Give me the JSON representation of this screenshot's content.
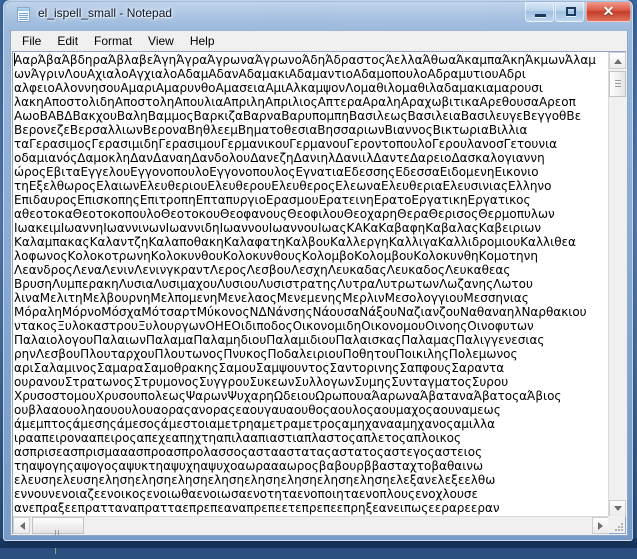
{
  "window": {
    "title": "el_ispell_small - Notepad",
    "icon": "notepad-document-icon",
    "controls": {
      "minimize": "–",
      "maximize": "□",
      "close": "✕"
    }
  },
  "menu": {
    "items": [
      {
        "label": "File"
      },
      {
        "label": "Edit"
      },
      {
        "label": "Format"
      },
      {
        "label": "View"
      },
      {
        "label": "Help"
      }
    ]
  },
  "document": {
    "word_wrap": false,
    "lines": [
      "ΑαρΆβαΆβδηραΆβλαβεΆγηΆγραΆγρωναΆγρωνοΆδηΆδραστοςΆελλαΆθωαΆκαμπαΆκηΆκμωνΆλαμ",
      "ωνΆγρινΛουΑχιαλοΑγχιαλοΑδαμΑδανΑδαμακιΑδαμαντιοΑδαμοπουλοΑδραμυτιουΑδρι",
      "αλφειοΑλοννησουΑμαριΑμαρυνθοΑμασειαΑμιΑλκαμψονΛομαθιλομαθιλαδαμακιαμαρουσι",
      "λακηΑποστολιδηΑποστοληΑπουλιαΑπριληΑπριλιοςΑπτεραΑραληΑραχωβιτικαΑρεθουσαΑρεοπ",
      "ΑωοΒΑΒΔΒακχουΒαληΒαμμοςΒαρκιζαΒαρναΒαρυπομπηΒασιλεωςΒασιλειαΒασιλευγεΒεγγοθΒε",
      "ΒερονεζεΒερσαλλιωνΒεροναΒηθλεεμΒηματοθεσιαΒησσαριωνΒιαννοςΒικτωριαΒιλλια",
      "ταΓερασιμοςΓερασιμιδηΓερασιμουΓερμανικουΓερμανουΓεροντοπουλοΓερουλανοσΓετουνια",
      "οδαμιανόςΔαμοκληΔανΔαναηΔανδολουΔανεζηΔανιηλΔανιιλΔαντεΔαρειοΔασκαλογιαννη",
      "ώροςΕβιταΕγγελουΕγγονοπουλοΕγγονοπουλοςΕγνατιαΕδεσσηςΕδεσσαΕιδομενηΕικονιο",
      "τηΕξελθωροςΕλαιωνΕλευθεριουΕλευθερουΕλευθεροςΕλεωναΕλευθεριαΕλευσινιαςΕλληνο",
      "ΕπιδαυροςΕπισκοπηςΕπιτροπηΕπταπυργιοΕρασμουΕρατεινηΕρατοΕργατικηΕργατικος",
      "αθεοτοκαΘεοτοκοπουλοΘεοτοκουΘεοφανουςΘεοφιλουΘεοχαρηΘεραΘερισοςΘερμοπυλων",
      "ΙωακειμΙωαννηΙωαννινωνΙωαννιδηΙωαννουΙωαννουΙωαςΚΑΚαΚαβαφηΚαβαλαςΚαβειριων",
      "ΚαλαμπακαςΚαλαντζηΚαλαποθακηΚαλαφατηΚαλβουΚαλλεργηΚαλλιγαΚαλλιδρομιουΚαλλιθεα",
      "λοφωνοςΚολοκοτρωνηΚολοκυνθουΚολοκυνθουςΚολομβοΚολομβουΚολοκυνθηΚομοτηνη",
      "ΛεανδροςΛεναΛενινΛενινγκραντΛεροςΛεσβουΛεσχηΛευκαδαςΛευκαδοςΛευκαθεας",
      "ΒρυσηΛυμπερακηΛυσιαΛυσιμαχουΛυσιουΛυσιστρατηςΛυτραΛυτρωτωνΛωζανηςΛωτου",
      "λιναΜελιτηΜελβουρνηΜελπομενηΜενελαοςΜενεμενηςΜερλινΜεσολογγιουΜεσσηνιας",
      "ΜόραληΜόρνοΜόσχαΜότσαρτΜύκονοςΝΔΝάνσηςΝάουσαΝάξουΝαζιανζουΝαθαναηλΝαρθακιου",
      "ντακοςΞυλοκαστρουΞυλουργωνΟΗΕΟιδιποδοςΟικονομιδηΟικονομουΟινοηςΟινοφυτων",
      "ΠαλαιολογουΠαλαιωνΠαλαμαΠαλαμηδιουΠαλαμιδιουΠαλαισκαςΠαλαμαςΠαλιγγενεσιας",
      "ρηνΛεσβουΠλουταρχουΠλουτωνοςΠνυκοςΠοδαλειριουΠοθητουΠοικιληςΠολεμωνος",
      "αριΣαλαμινοςΣαμαραΣαμοθρακηςΣαμουΣαμψουντοςΣαντορινηςΣαπφουςΣαραντα",
      "ουρανουΣτρατωνοςΣτρυμονοςΣυγγρουΣυκεωνΣυλλογωνΣυμηςΣυνταγματοςΣυρου",
      "ΧρυσοστομουΧρυσουπολεωςΨαρωνΨυχαρηΩδειουΩρωπουαΆαρωναΆβαταναΆβατοςαΆβιος",
      "ουβλααουοληαουουλουαοραςανοραςεαουγαυαουθοςαουλοςαουμαχοςαουναμεως",
      "άμεμπτοςάμεσηςάμεσοςάμεστοιαμετρηαμετραμετροςαμηχανααμηχανοςαμιλλα",
      "ιρααπειρονααπειροςαπεχεαπηχτηαπιλααπιαστιαπλαστοςαπλετοςαπλοικος",
      "ασπρισεασπρισμααασπροασπρολασσοςασταασταταςαστατοςαστεγοςαστειος",
      "τηαψογηςαψογοςαψυκτηαψυχηαψυχοαωραααωροςβαβουρββασταχτοβαθαινω",
      "ελευσηελευσηελησηελησηελησηελησηελησηελησηελησηελησηελεξανελεξεελθω",
      "εννουνενοιαζεενοικοςενοιωθαενοιωσαενοτηταενοποιηταενοπλουςενοχλουσε",
      "ανεπραξεεπρατταναπρατταεπρεπεαναπρεπεετεπρεπεεπρηξεανειπωςεεραρεεραν"
    ]
  },
  "scrollbars": {
    "vertical": {
      "up_arrow": "▲",
      "down_arrow": "▼",
      "thumb_position": "near-top",
      "thumb_size_ratio": 0.06
    },
    "horizontal": {
      "left_arrow": "◄",
      "right_arrow": "►",
      "thumb_position": "near-left",
      "thumb_size_ratio": 0.09
    }
  },
  "colors": {
    "titlebar_glass": "#8eb0d6",
    "close_button": "#c33c27",
    "client_bg": "#f0f0f0",
    "text_bg": "#ffffff",
    "text_fg": "#000000",
    "frame_border": "#8ba6c4",
    "desktop": "#4a79b4"
  }
}
